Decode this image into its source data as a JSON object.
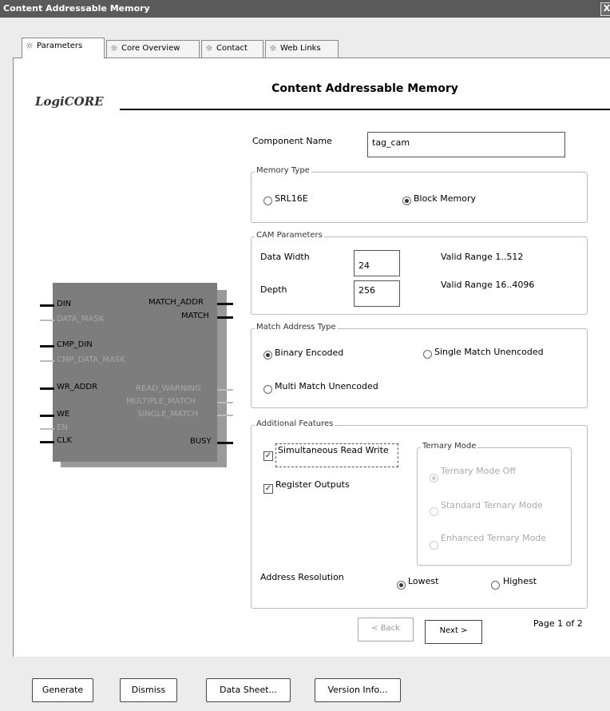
{
  "window": {
    "title": "Content Addressable Memory",
    "close_glyph": "X"
  },
  "tabs": [
    {
      "label": "Parameters",
      "icon": "bulb-icon"
    },
    {
      "label": "Core Overview",
      "icon": "bulb-icon"
    },
    {
      "label": "Contact",
      "icon": "bulb-icon"
    },
    {
      "label": "Web Links",
      "icon": "bulb-icon"
    }
  ],
  "header": {
    "logo": "LogiCORE",
    "title": "Content Addressable Memory"
  },
  "component": {
    "label": "Component Name",
    "value": "tag_cam"
  },
  "memory_type": {
    "legend": "Memory Type",
    "options": [
      {
        "label": "SRL16E",
        "selected": false
      },
      {
        "label": "Block Memory",
        "selected": true
      }
    ]
  },
  "cam": {
    "legend": "CAM Parameters",
    "data_width": {
      "label": "Data Width",
      "value": "24",
      "range": "Valid Range 1..512"
    },
    "depth": {
      "label": "Depth",
      "value": "256",
      "range": "Valid Range 16..4096"
    }
  },
  "match_type": {
    "legend": "Match Address Type",
    "options": [
      {
        "label": "Binary Encoded",
        "selected": true
      },
      {
        "label": "Single Match Unencoded",
        "selected": false
      },
      {
        "label": "Multi Match Unencoded",
        "selected": false
      }
    ]
  },
  "features": {
    "legend": "Additional Features",
    "sim_rw": {
      "label": "Simultaneous Read Write",
      "checked": true
    },
    "reg_out": {
      "label": "Register Outputs",
      "checked": true
    },
    "ternary": {
      "legend": "Ternary Mode",
      "options": [
        {
          "label": "Ternary Mode Off",
          "selected": true
        },
        {
          "label": "Standard Ternary Mode",
          "selected": false
        },
        {
          "label": "Enhanced Ternary Mode",
          "selected": false
        }
      ]
    },
    "addr_res": {
      "label": "Address Resolution",
      "options": [
        {
          "label": "Lowest",
          "selected": true
        },
        {
          "label": "Highest",
          "selected": false
        }
      ]
    }
  },
  "nav": {
    "back": "< Back",
    "next": "Next >",
    "page": "Page 1 of 2"
  },
  "symbol": {
    "left_pins": [
      "DIN",
      "DATA_MASK",
      "CMP_DIN",
      "CMP_DATA_MASK",
      "WR_ADDR",
      "WE",
      "EN",
      "CLK"
    ],
    "right_pins": [
      "MATCH_ADDR",
      "MATCH",
      "READ_WARNING",
      "MULTIPLE_MATCH",
      "SINGLE_MATCH",
      "BUSY"
    ]
  },
  "bottom": {
    "generate": "Generate",
    "dismiss": "Dismiss",
    "datasheet": "Data Sheet...",
    "version": "Version Info..."
  }
}
